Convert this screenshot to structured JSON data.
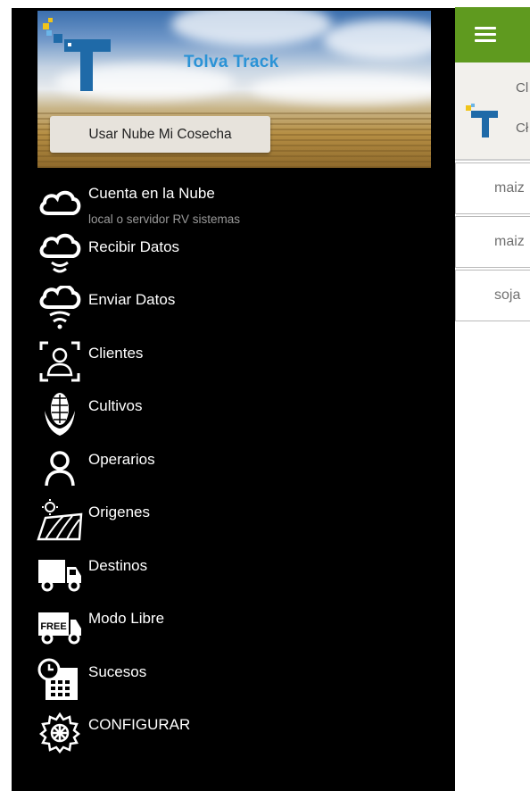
{
  "drawer": {
    "brand_name": "Tolva Track",
    "cloud_button_label": "Usar Nube Mi Cosecha",
    "items": [
      {
        "label": "Cuenta en la Nube",
        "subtitle": "local o servidor RV sistemas",
        "icon": "cloud-icon"
      },
      {
        "label": "Recibir Datos",
        "icon": "cloud-download-icon"
      },
      {
        "label": "Enviar Datos",
        "icon": "cloud-upload-icon"
      },
      {
        "label": "Clientes",
        "icon": "client-scan-icon"
      },
      {
        "label": "Cultivos",
        "icon": "corn-icon"
      },
      {
        "label": "Operarios",
        "icon": "person-icon"
      },
      {
        "label": "Origenes",
        "icon": "field-icon"
      },
      {
        "label": "Destinos",
        "icon": "truck-icon"
      },
      {
        "label": "Modo Libre",
        "icon": "free-truck-icon"
      },
      {
        "label": "Sucesos",
        "icon": "calendar-clock-icon"
      },
      {
        "label": "CONFIGURAR",
        "icon": "gear-icon"
      }
    ],
    "free_badge": "FREE"
  },
  "background": {
    "header_cl": "Cl",
    "header_ch": "Cł",
    "rows": [
      "maiz",
      "maiz",
      "soja"
    ]
  },
  "colors": {
    "topbar": "#5f9a1f",
    "drawer_bg": "#000000",
    "brand_text": "#2b93d6"
  }
}
